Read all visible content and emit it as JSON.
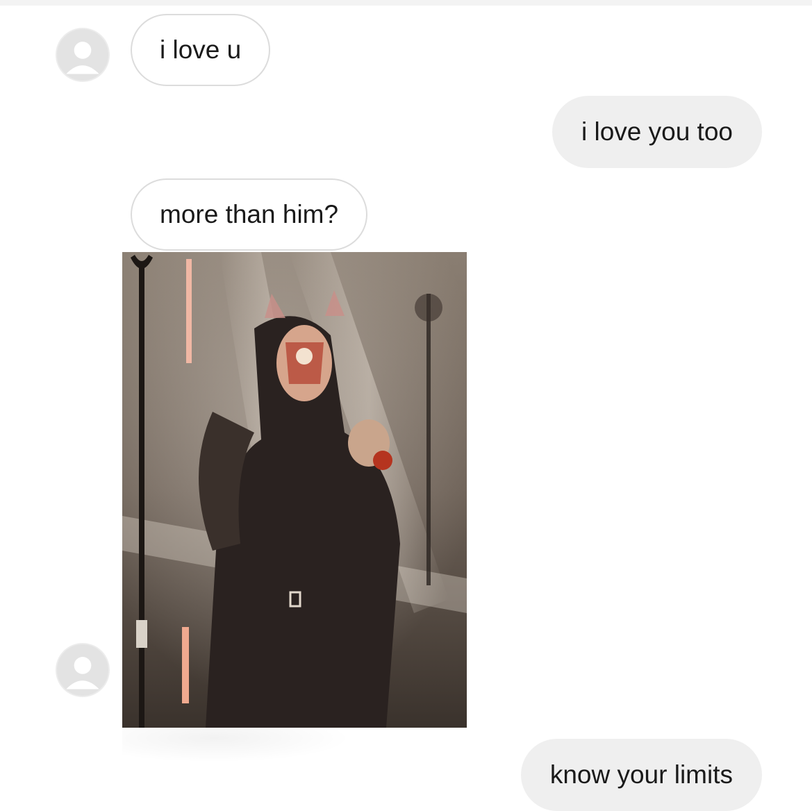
{
  "thread": {
    "messages": [
      {
        "direction": "incoming",
        "text": "i love u"
      },
      {
        "direction": "outgoing",
        "text": "i love you too"
      },
      {
        "direction": "incoming",
        "text": "more than him?"
      },
      {
        "direction": "incoming",
        "type": "photo",
        "icon": "concert-photo"
      },
      {
        "direction": "outgoing",
        "text": "know your limits"
      }
    ]
  },
  "avatar_icon": "default-user-avatar-icon",
  "colors": {
    "incoming_bubble_border": "#dcdcdc",
    "outgoing_bubble_fill": "#efefef",
    "avatar_fill": "#e3e3e3"
  }
}
